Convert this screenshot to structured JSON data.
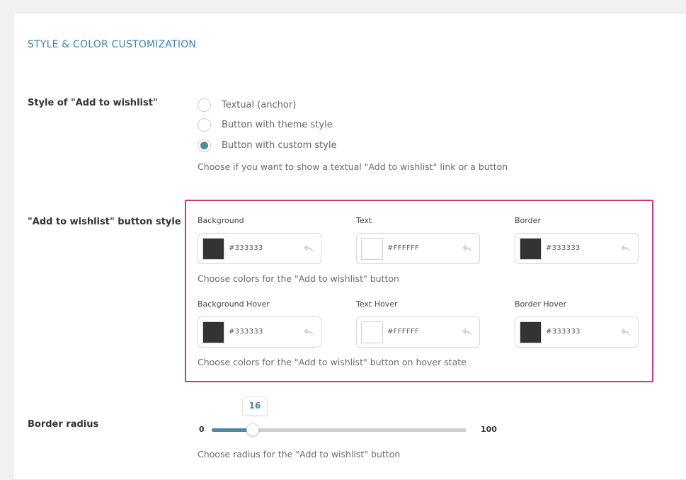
{
  "section": {
    "title": "STYLE & COLOR CUSTOMIZATION"
  },
  "wishlist_style": {
    "label": "Style of \"Add to wishlist\"",
    "options": [
      {
        "label": "Textual (anchor)",
        "checked": false
      },
      {
        "label": "Button with theme style",
        "checked": false
      },
      {
        "label": "Button with custom style",
        "checked": true
      }
    ],
    "description": "Choose if you want to show a textual \"Add to wishlist\" link or a button"
  },
  "button_style": {
    "label": "\"Add to wishlist\" button style",
    "colors": [
      {
        "label": "Background",
        "value": "#333333",
        "swatch": "#333333"
      },
      {
        "label": "Text",
        "value": "#FFFFFF",
        "swatch": "#FFFFFF"
      },
      {
        "label": "Border",
        "value": "#333333",
        "swatch": "#333333"
      }
    ],
    "colors_description": "Choose colors for the \"Add to wishlist\" button",
    "hover_colors": [
      {
        "label": "Background Hover",
        "value": "#333333",
        "swatch": "#333333"
      },
      {
        "label": "Text Hover",
        "value": "#FFFFFF",
        "swatch": "#FFFFFF"
      },
      {
        "label": "Border Hover",
        "value": "#333333",
        "swatch": "#333333"
      }
    ],
    "hover_description": "Choose colors for the \"Add to wishlist\" button on hover state",
    "reset_icon": "undo-arrow-icon"
  },
  "border_radius": {
    "label": "Border radius",
    "value": "16",
    "min": "0",
    "max": "100",
    "description": "Choose radius for the \"Add to wishlist\" button"
  },
  "theme": {
    "accent": "#4d8aa1",
    "title_color": "#3a86a8",
    "highlight": "#d6366b"
  }
}
